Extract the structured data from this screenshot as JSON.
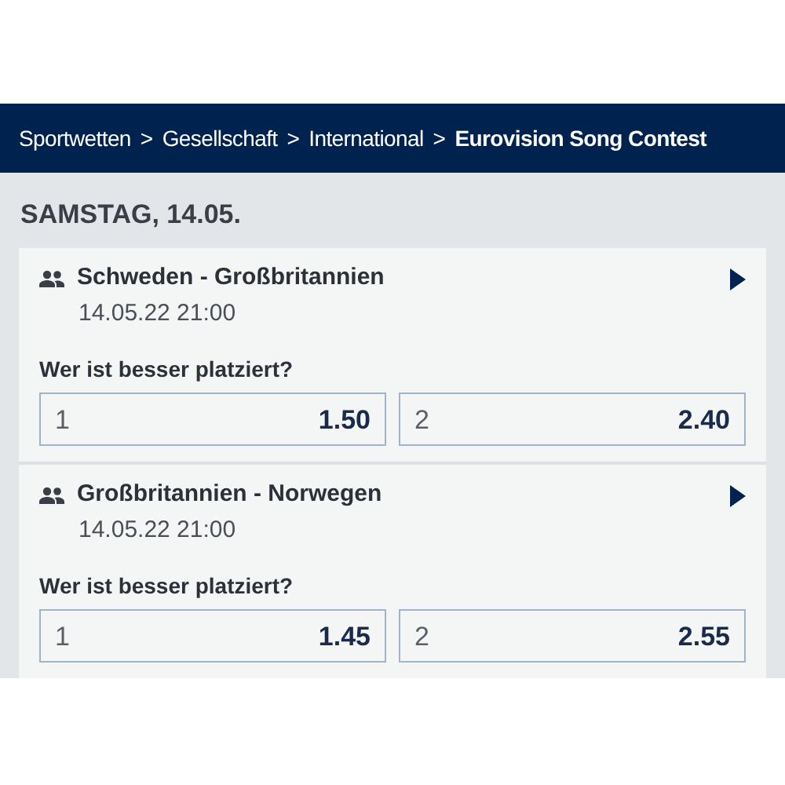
{
  "breadcrumb": [
    {
      "kind": "link",
      "label": "Sportwetten",
      "current": false
    },
    {
      "kind": "separator",
      "label": ">"
    },
    {
      "kind": "link",
      "label": "Gesellschaft",
      "current": false
    },
    {
      "kind": "separator",
      "label": ">"
    },
    {
      "kind": "link",
      "label": "International",
      "current": false
    },
    {
      "kind": "separator",
      "label": ">"
    },
    {
      "kind": "link",
      "label": "Eurovision Song Contest",
      "current": true
    }
  ],
  "day_heading": "SAMSTAG, 14.05.",
  "events": [
    {
      "title": "Schweden - Großbritannien",
      "time": "14.05.22 21:00",
      "market": "Wer ist besser platziert?",
      "odds": [
        {
          "outcome": "1",
          "price": "1.50"
        },
        {
          "outcome": "2",
          "price": "2.40"
        }
      ]
    },
    {
      "title": "Großbritannien - Norwegen",
      "time": "14.05.22 21:00",
      "market": "Wer ist besser platziert?",
      "odds": [
        {
          "outcome": "1",
          "price": "1.45"
        },
        {
          "outcome": "2",
          "price": "2.55"
        }
      ]
    }
  ]
}
